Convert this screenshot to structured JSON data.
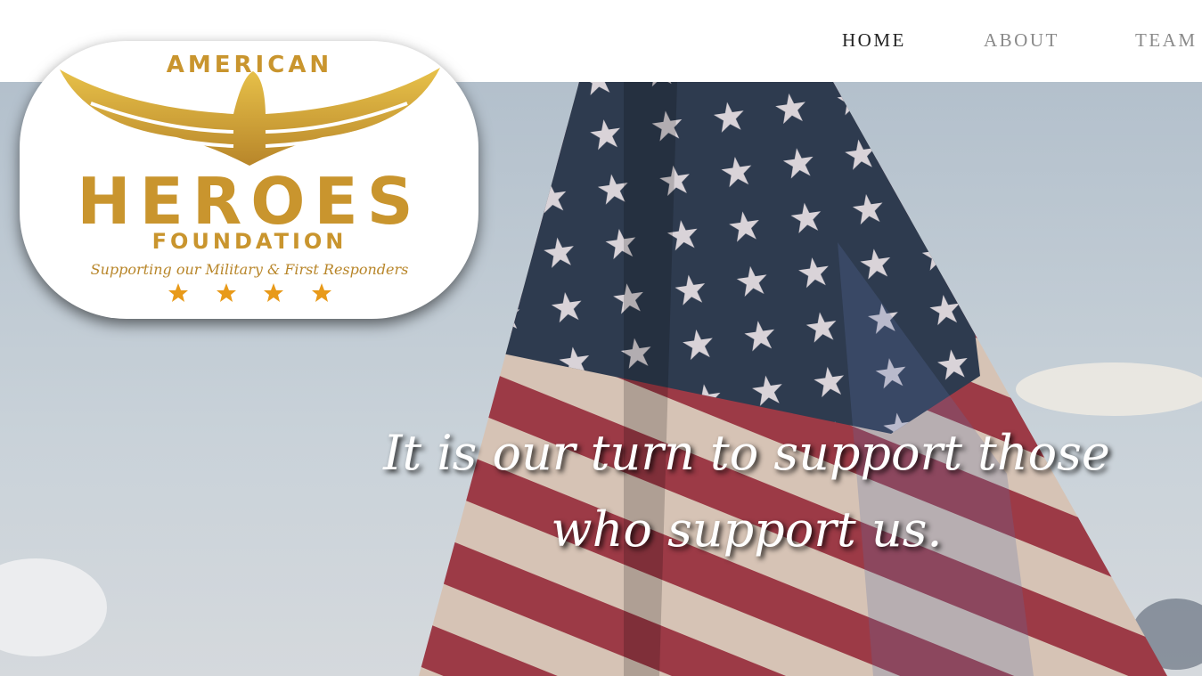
{
  "nav": {
    "items": [
      {
        "label": "HOME",
        "active": true
      },
      {
        "label": "ABOUT",
        "active": false
      },
      {
        "label": "TEAM",
        "active": false
      }
    ]
  },
  "logo": {
    "top_text": "AMERICAN",
    "main_text": "HEROES",
    "sub_text": "FOUNDATION",
    "script_text": "Supporting our Military & First Responders",
    "star_count": 4,
    "gold_color": "#c9952e"
  },
  "hero": {
    "tagline": "It is our turn to support those who support us.",
    "background": "american-flag-sky-photo"
  }
}
